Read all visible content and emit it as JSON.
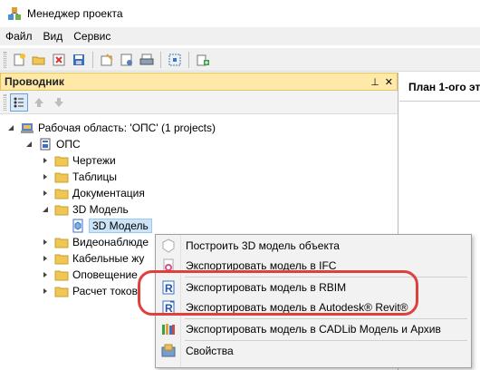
{
  "window": {
    "title": "Менеджер проекта"
  },
  "menu": [
    "Файл",
    "Вид",
    "Сервис"
  ],
  "explorer": {
    "title": "Проводник",
    "pin_glyph": "⊥",
    "close_glyph": "✕"
  },
  "tree": {
    "workspace": "Рабочая область: 'ОПС' (1 projects)",
    "project": "ОПС",
    "items": {
      "drawings": "Чертежи",
      "tables": "Таблицы",
      "docs": "Документация",
      "model3d": "3D Модель",
      "model3d_child": "3D Модель",
      "video": "Видеонаблюде",
      "cable": "Кабельные жу",
      "alert": "Оповещение",
      "current": "Расчет токов"
    }
  },
  "right_tab": {
    "title": "План 1-ого эт"
  },
  "context_menu": [
    {
      "label": "Построить 3D модель объекта",
      "icon": "cube-icon"
    },
    {
      "label": "Экспортировать модель в IFC",
      "icon": "ifc-icon"
    },
    {
      "label": "Экспортировать модель в RBIM",
      "icon": "rbim-icon"
    },
    {
      "label": "Экспортировать модель в Autodesk® Revit®",
      "icon": "revit-icon"
    },
    {
      "label": "Экспортировать модель в CADLib Модель и Архив",
      "icon": "cadlib-icon"
    },
    {
      "label": "Свойства",
      "icon": "properties-icon"
    }
  ],
  "colors": {
    "panel_header": "#ffe9a8",
    "selection": "#cce4f7",
    "highlight": "#e0403c"
  }
}
